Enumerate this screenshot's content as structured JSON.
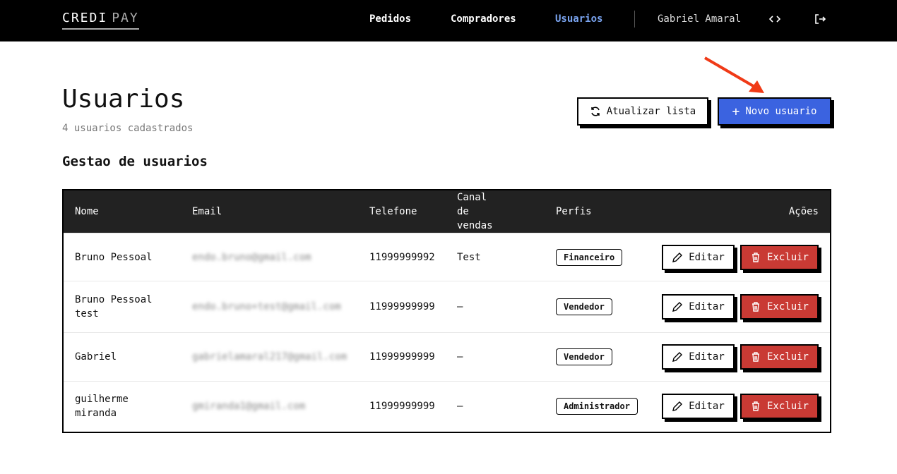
{
  "nav": {
    "logo_a": "CREDI",
    "logo_b": "PAY",
    "items": [
      "Pedidos",
      "Compradores",
      "Usuarios"
    ],
    "active": "Usuarios",
    "user": "Gabriel Amaral"
  },
  "page": {
    "title": "Usuarios",
    "subtitle": "4 usuarios cadastrados",
    "section": "Gestao de usuarios",
    "refresh_label": "Atualizar lista",
    "new_label": "Novo usuario"
  },
  "table": {
    "headers": [
      "Nome",
      "Email",
      "Telefone",
      "Canal de vendas",
      "Perfis",
      "Ações"
    ],
    "rows": [
      {
        "nome": "Bruno Pessoal",
        "email": "endo.bruno@gmail.com",
        "telefone": "11999999992",
        "canal": "Test",
        "perfil": "Financeiro"
      },
      {
        "nome": "Bruno Pessoal test",
        "email": "endo.bruno+test@gmail.com",
        "telefone": "11999999999",
        "canal": "–",
        "perfil": "Vendedor"
      },
      {
        "nome": "Gabriel",
        "email": "gabrielamaral217@gmail.com",
        "telefone": "11999999999",
        "canal": "–",
        "perfil": "Vendedor"
      },
      {
        "nome": "guilherme miranda",
        "email": "gmiranda1@gmail.com",
        "telefone": "11999999999",
        "canal": "–",
        "perfil": "Administrador"
      }
    ],
    "edit_label": "Editar",
    "delete_label": "Excluir"
  },
  "colors": {
    "primary": "#3b63e0",
    "danger": "#c93a34",
    "nav_active": "#7aa4f0"
  }
}
